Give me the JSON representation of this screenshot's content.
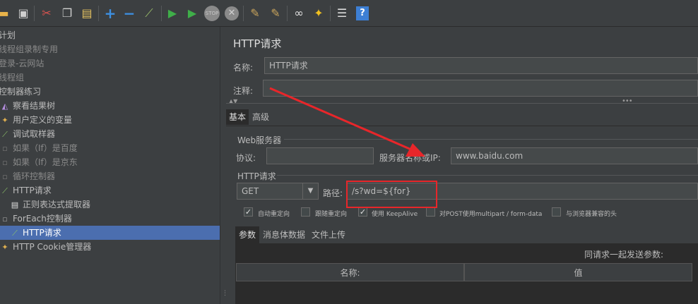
{
  "toolbar": {
    "icons": [
      "open-icon",
      "save-icon",
      "cut-icon",
      "copy-icon",
      "paste-icon",
      "expand-icon",
      "collapse-icon",
      "toggle-icon",
      "start-icon",
      "start-no-pause-icon",
      "stop-icon",
      "shutdown-icon",
      "clear-icon",
      "clear-all-icon",
      "search-icon",
      "reset-search-icon",
      "function-helper-icon",
      "help-icon"
    ]
  },
  "tree": {
    "items": [
      {
        "label": "计划",
        "disabled": false,
        "indent": 0,
        "icon": "plan-icon"
      },
      {
        "label": "线程组录制专用",
        "disabled": true,
        "indent": 0,
        "icon": "thread-group-icon"
      },
      {
        "label": "登录-云网站",
        "disabled": true,
        "indent": 0,
        "icon": "thread-group-icon"
      },
      {
        "label": "线程组",
        "disabled": true,
        "indent": 0,
        "icon": "thread-group-icon"
      },
      {
        "label": "控制器练习",
        "disabled": false,
        "indent": 0,
        "icon": "thread-group-icon"
      },
      {
        "label": "察看结果树",
        "disabled": false,
        "indent": 1,
        "icon": "listener-icon"
      },
      {
        "label": "用户定义的变量",
        "disabled": false,
        "indent": 1,
        "icon": "config-icon"
      },
      {
        "label": "调试取样器",
        "disabled": false,
        "indent": 1,
        "icon": "sampler-icon"
      },
      {
        "label": "如果（If）是百度",
        "disabled": true,
        "indent": 1,
        "icon": "controller-icon"
      },
      {
        "label": "如果（If）是京东",
        "disabled": true,
        "indent": 1,
        "icon": "controller-icon"
      },
      {
        "label": "循环控制器",
        "disabled": true,
        "indent": 1,
        "icon": "controller-icon"
      },
      {
        "label": "HTTP请求",
        "disabled": false,
        "indent": 1,
        "icon": "sampler-icon"
      },
      {
        "label": "正则表达式提取器",
        "disabled": false,
        "indent": 2,
        "icon": "extractor-icon"
      },
      {
        "label": "ForEach控制器",
        "disabled": false,
        "indent": 1,
        "icon": "controller-icon"
      },
      {
        "label": "HTTP请求",
        "disabled": false,
        "indent": 2,
        "icon": "sampler-icon",
        "selected": true
      },
      {
        "label": "HTTP Cookie管理器",
        "disabled": false,
        "indent": 1,
        "icon": "config-icon"
      }
    ]
  },
  "panel": {
    "title": "HTTP请求",
    "name_label": "名称:",
    "name_value": "HTTP请求",
    "comment_label": "注释:",
    "comment_value": "",
    "tabs": [
      "基本",
      "高级"
    ],
    "web_server_group": "Web服务器",
    "protocol_label": "协议:",
    "protocol_value": "",
    "server_label": "服务器名称或IP:",
    "server_value": "www.baidu.com",
    "http_request_group": "HTTP请求",
    "method_value": "GET",
    "path_label": "路径:",
    "path_value": "/s?wd=${for}",
    "checkboxes": [
      {
        "label": "自动重定向",
        "checked": true
      },
      {
        "label": "跟随重定向",
        "checked": false
      },
      {
        "label": "使用 KeepAlive",
        "checked": true
      },
      {
        "label": "对POST使用multipart / form-data",
        "checked": false
      },
      {
        "label": "与浏览器兼容的头",
        "checked": false
      }
    ],
    "sub_tabs": [
      "参数",
      "消息体数据",
      "文件上传"
    ],
    "send_params_label": "同请求一起发送参数:",
    "table_headers": [
      "名称:",
      "值"
    ]
  },
  "colors": {
    "accent_selected": "#4b6eaf",
    "annotation_red": "#e8262a"
  }
}
